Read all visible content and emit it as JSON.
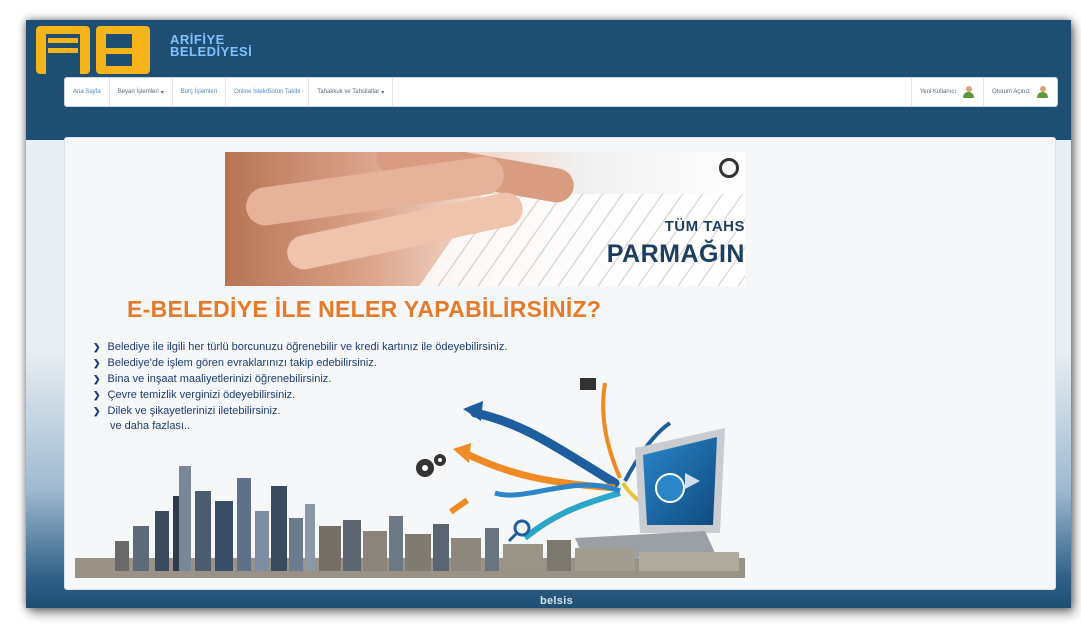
{
  "header": {
    "brand_line1": "ARİFİYE",
    "brand_line2": "BELEDİYESİ"
  },
  "nav": {
    "items": [
      {
        "label": "Ana Sayfa"
      },
      {
        "label": "Beyan İşlemleri",
        "caret": "▾"
      },
      {
        "label": "Borç İşlemleri"
      },
      {
        "label": "Online İstek/Sorun Takibi"
      },
      {
        "label": "Tahakkuk ve Tahsilatlar",
        "caret": "▾"
      }
    ],
    "right": [
      {
        "label": "Yeni Kullanıcı",
        "icon": "user-icon"
      },
      {
        "label": "Oturum Açınız",
        "icon": "user-group-icon"
      }
    ]
  },
  "banner": {
    "text1": "TÜM TAHS",
    "text2": "PARMAĞIN"
  },
  "promo": {
    "title": "E-BELEDİYE İLE NELER YAPABİLİRSİNİZ?",
    "items": [
      "Belediye ile ilgili her türlü borcunuzu öğrenebilir ve kredi kartınız ile ödeyebilirsiniz.",
      "Belediye'de işlem gören evraklarınızı takip edebilirsiniz.",
      "Bina ve inşaat maaliyetlerinizi öğrenebilirsiniz.",
      "Çevre temizlik verginizi ödeyebilirsiniz.",
      "Dilek ve şikayetlerinizi iletebilirsiniz."
    ],
    "more": "ve daha fazlası.."
  },
  "footer": {
    "brand": "belsis"
  },
  "colors": {
    "header_bg": "#1f4e73",
    "brand_text": "#7fc2ff",
    "logo": "#f6b31a",
    "promo_title": "#e57b2a",
    "promo_text": "#1e3c74"
  }
}
